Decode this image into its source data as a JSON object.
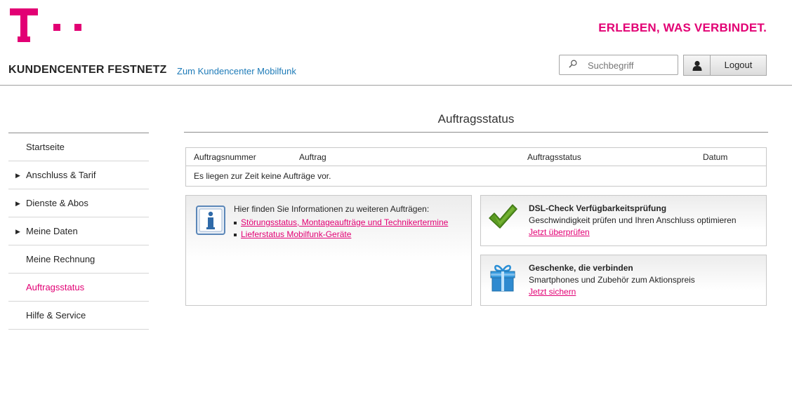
{
  "brand": {
    "slogan": "ERLEBEN, WAS VERBINDET.",
    "accent_color": "#e20074"
  },
  "header": {
    "portal_title": "KUNDENCENTER FESTNETZ",
    "mobil_link": "Zum Kundencenter Mobilfunk",
    "search_placeholder": "Suchbegriff",
    "user_icon": "user-icon",
    "logout_label": "Logout"
  },
  "sidebar": {
    "items": [
      {
        "label": "Startseite",
        "has_arrow": false,
        "active": false
      },
      {
        "label": "Anschluss & Tarif",
        "has_arrow": true,
        "active": false
      },
      {
        "label": "Dienste & Abos",
        "has_arrow": true,
        "active": false
      },
      {
        "label": "Meine Daten",
        "has_arrow": true,
        "active": false
      },
      {
        "label": "Meine Rechnung",
        "has_arrow": false,
        "active": false
      },
      {
        "label": "Auftragsstatus",
        "has_arrow": false,
        "active": true
      },
      {
        "label": "Hilfe & Service",
        "has_arrow": false,
        "active": false
      }
    ]
  },
  "main": {
    "title": "Auftragsstatus",
    "table": {
      "columns": [
        "Auftragsnummer",
        "Auftrag",
        "Auftragsstatus",
        "Datum"
      ],
      "empty_message": "Es liegen zur Zeit keine Aufträge vor."
    },
    "info_box": {
      "icon": "info-icon",
      "intro": "Hier finden Sie Informationen zu weiteren Aufträgen:",
      "links": [
        "Störungsstatus, Montageaufträge und Technikertermine",
        "Lieferstatus Mobilfunk-Geräte"
      ]
    },
    "promos": [
      {
        "icon": "checkmark-icon",
        "title": "DSL-Check Verfügbarkeitsprüfung",
        "text": "Geschwindigkeit prüfen und Ihren Anschluss optimieren",
        "link": "Jetzt überprüfen"
      },
      {
        "icon": "gift-icon",
        "title": "Geschenke, die verbinden",
        "text": "Smartphones und Zubehör zum Aktionspreis",
        "link": "Jetzt sichern"
      }
    ]
  }
}
